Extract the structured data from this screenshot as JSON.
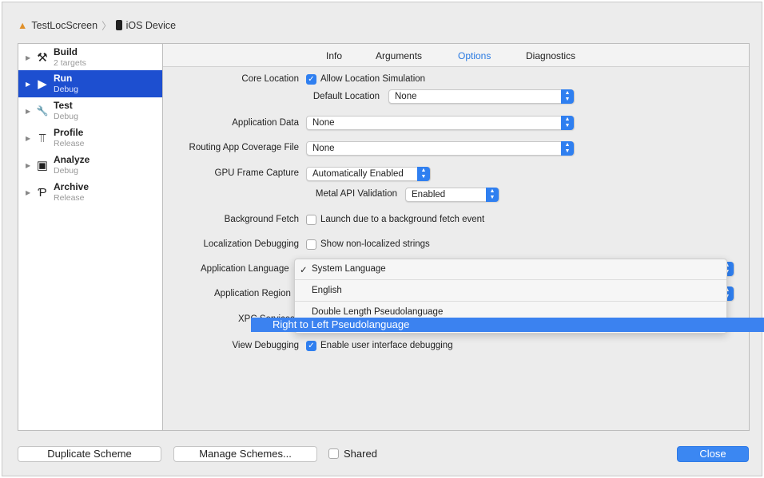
{
  "breadcrumb": {
    "project": "TestLocScreen",
    "device": "iOS Device"
  },
  "sidebar": {
    "items": [
      {
        "title": "Build",
        "subtitle": "2 targets",
        "icon": "hammer-icon",
        "glyph": "⚒"
      },
      {
        "title": "Run",
        "subtitle": "Debug",
        "icon": "play-icon",
        "glyph": "▶"
      },
      {
        "title": "Test",
        "subtitle": "Debug",
        "icon": "wrench-icon",
        "glyph": "🔧"
      },
      {
        "title": "Profile",
        "subtitle": "Release",
        "icon": "instruments-icon",
        "glyph": "⫪"
      },
      {
        "title": "Analyze",
        "subtitle": "Debug",
        "icon": "analyze-icon",
        "glyph": "▣"
      },
      {
        "title": "Archive",
        "subtitle": "Release",
        "icon": "archive-icon",
        "glyph": "Ƥ"
      }
    ]
  },
  "tabs": [
    "Info",
    "Arguments",
    "Options",
    "Diagnostics"
  ],
  "active_tab": "Options",
  "options": {
    "core_location": "Core Location",
    "allow_location": "Allow Location Simulation",
    "default_location": "Default Location",
    "default_location_value": "None",
    "app_data": "Application Data",
    "app_data_value": "None",
    "routing": "Routing App Coverage File",
    "routing_value": "None",
    "gpu": "GPU Frame Capture",
    "gpu_value": "Automatically Enabled",
    "metal": "Metal API Validation",
    "metal_value": "Enabled",
    "bg_fetch": "Background Fetch",
    "bg_fetch_cb": "Launch due to a background fetch event",
    "loc_debug": "Localization Debugging",
    "loc_debug_cb": "Show non-localized strings",
    "app_lang": "Application Language",
    "app_region": "Application Region",
    "xpc": "XPC Services",
    "view_debug": "View Debugging",
    "view_debug_cb": "Enable user interface debugging"
  },
  "language_menu": {
    "check": "✓",
    "items": [
      "System Language",
      "English",
      "Double Length Pseudolanguage",
      "Right to Left Pseudolanguage"
    ],
    "selected": "System Language",
    "highlighted": "Right to Left Pseudolanguage"
  },
  "footer": {
    "duplicate": "Duplicate Scheme",
    "manage": "Manage Schemes...",
    "shared": "Shared",
    "close": "Close"
  },
  "colors": {
    "accent": "#2f7ff0",
    "selection": "#1d4fd0"
  }
}
